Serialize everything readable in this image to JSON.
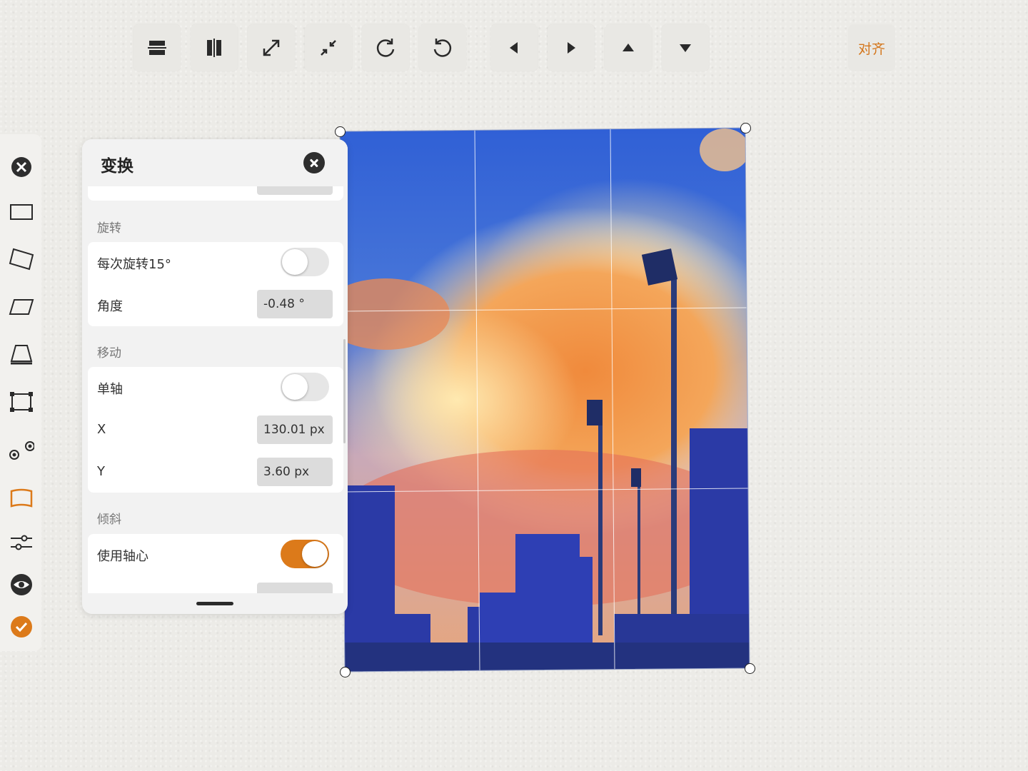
{
  "toolbar": {
    "buttons": [
      {
        "icon": "flip-vertical-icon"
      },
      {
        "icon": "flip-horizontal-icon"
      },
      {
        "icon": "expand-icon"
      },
      {
        "icon": "shrink-icon"
      },
      {
        "icon": "rotate-clockwise-icon"
      },
      {
        "icon": "rotate-counterclockwise-icon"
      },
      {
        "icon": "arrow-left-icon"
      },
      {
        "icon": "arrow-right-icon"
      },
      {
        "icon": "arrow-up-icon"
      },
      {
        "icon": "arrow-down-icon"
      }
    ],
    "align_label": "对齐"
  },
  "colors": {
    "accent": "#dc7a1a",
    "panel": "#f2f2f2"
  },
  "panel": {
    "title": "变换",
    "rotate": {
      "section": "旋转",
      "snap_label": "每次旋转15°",
      "snap_on": false,
      "angle_label": "角度",
      "angle_value": "-0.48 °"
    },
    "move": {
      "section": "移动",
      "single_axis_label": "单轴",
      "single_axis_on": false,
      "x_label": "X",
      "x_value": "130.01 px",
      "y_label": "Y",
      "y_value": "3.60 px"
    },
    "skew": {
      "section": "倾斜",
      "pivot_label": "使用轴心",
      "pivot_on": true
    }
  },
  "rail": [
    "close-circle-icon",
    "rectangle-icon",
    "rotated-rect-icon",
    "parallelogram-icon",
    "trapezoid-icon",
    "free-transform-icon",
    "pivot-points-icon",
    "warp-icon",
    "sliders-icon",
    "eye-icon",
    "confirm-icon"
  ]
}
